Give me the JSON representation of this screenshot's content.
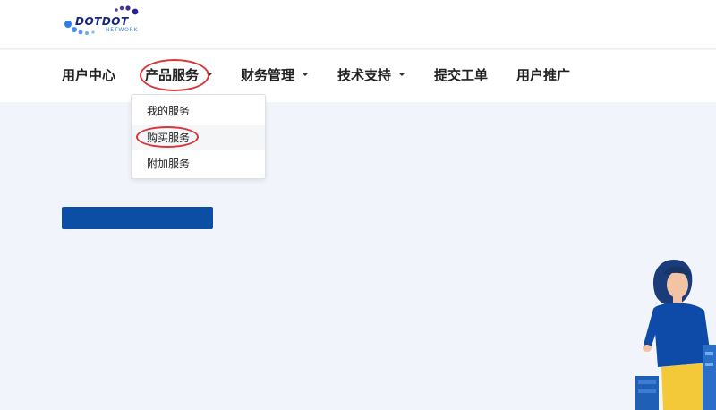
{
  "brand": {
    "logo_main": "DOTDOT",
    "logo_sub": "NETWORK",
    "primary_color": "#0b4ea3",
    "highlight_color": "#d7363b"
  },
  "nav": {
    "items": [
      {
        "label": "用户中心",
        "has_caret": false
      },
      {
        "label": "产品服务",
        "has_caret": true
      },
      {
        "label": "财务管理",
        "has_caret": true
      },
      {
        "label": "技术支持",
        "has_caret": true
      },
      {
        "label": "提交工单",
        "has_caret": false
      },
      {
        "label": "用户推广",
        "has_caret": false
      }
    ]
  },
  "dropdown": {
    "items": [
      {
        "label": "我的服务"
      },
      {
        "label": "购买服务"
      },
      {
        "label": "附加服务"
      }
    ]
  }
}
